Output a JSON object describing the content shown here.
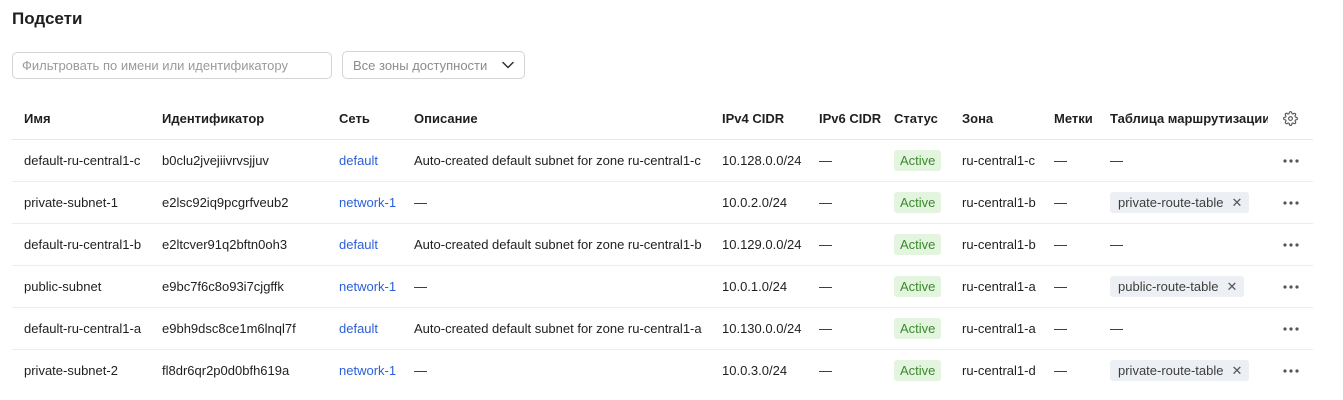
{
  "page": {
    "title": "Подсети"
  },
  "filters": {
    "search_placeholder": "Фильтровать по имени или идентификатору",
    "search_value": "",
    "zone_selected": "Все зоны доступности",
    "zone_icon": "chevron-down-icon"
  },
  "table": {
    "columns": [
      "Имя",
      "Идентификатор",
      "Сеть",
      "Описание",
      "IPv4 CIDR",
      "IPv6 CIDR",
      "Статус",
      "Зона",
      "Метки",
      "Таблица маршрутизации"
    ],
    "settings_icon": "gear-icon",
    "row_menu_icon": "more-horizontal-icon",
    "tag_remove_icon": "close-icon",
    "status_color": "#3a8a2c",
    "status_bg": "#e3f4df",
    "link_color": "#2b5fd9",
    "rows": [
      {
        "name": "default-ru-central1-c",
        "id": "b0clu2jvejiivrvsjjuv",
        "network": "default",
        "description": "Auto-created default subnet for zone ru-central1-c",
        "ipv4": "10.128.0.0/24",
        "ipv6": "—",
        "status": "Active",
        "zone": "ru-central1-c",
        "labels": "—",
        "route_table": "—"
      },
      {
        "name": "private-subnet-1",
        "id": "e2lsc92iq9pcgrfveub2",
        "network": "network-1",
        "description": "—",
        "ipv4": "10.0.2.0/24",
        "ipv6": "—",
        "status": "Active",
        "zone": "ru-central1-b",
        "labels": "—",
        "route_table": "private-route-table"
      },
      {
        "name": "default-ru-central1-b",
        "id": "e2ltcver91q2bftn0oh3",
        "network": "default",
        "description": "Auto-created default subnet for zone ru-central1-b",
        "ipv4": "10.129.0.0/24",
        "ipv6": "—",
        "status": "Active",
        "zone": "ru-central1-b",
        "labels": "—",
        "route_table": "—"
      },
      {
        "name": "public-subnet",
        "id": "e9bc7f6c8o93i7cjgffk",
        "network": "network-1",
        "description": "—",
        "ipv4": "10.0.1.0/24",
        "ipv6": "—",
        "status": "Active",
        "zone": "ru-central1-a",
        "labels": "—",
        "route_table": "public-route-table"
      },
      {
        "name": "default-ru-central1-a",
        "id": "e9bh9dsc8ce1m6lnql7f",
        "network": "default",
        "description": "Auto-created default subnet for zone ru-central1-a",
        "ipv4": "10.130.0.0/24",
        "ipv6": "—",
        "status": "Active",
        "zone": "ru-central1-a",
        "labels": "—",
        "route_table": "—"
      },
      {
        "name": "private-subnet-2",
        "id": "fl8dr6qr2p0d0bfh619a",
        "network": "network-1",
        "description": "—",
        "ipv4": "10.0.3.0/24",
        "ipv6": "—",
        "status": "Active",
        "zone": "ru-central1-d",
        "labels": "—",
        "route_table": "private-route-table"
      }
    ]
  }
}
